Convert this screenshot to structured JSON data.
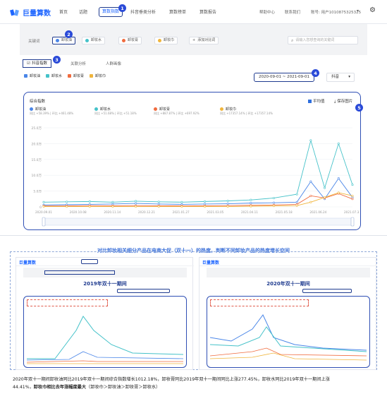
{
  "app": {
    "name": "巨量算数"
  },
  "nav": {
    "items": [
      "首页",
      "话题",
      "算数指数",
      "抖音垂类分析",
      "算数榜单",
      "算数报告"
    ],
    "active_index": 2
  },
  "top_right": {
    "help": "帮助中心",
    "contact": "联系我们",
    "user": "账号: 用户1010875325325"
  },
  "keywords": {
    "label": "关键词",
    "items": [
      "卸妆油",
      "卸妆水",
      "卸妆膏",
      "卸妆巾"
    ],
    "add_label": "添加对比词",
    "search_placeholder": "请输入您想查询的关键词"
  },
  "tabs": {
    "items": [
      "抖音指数",
      "关联分析",
      "人群画像"
    ]
  },
  "legend_filters": [
    "卸妆油",
    "卸妆水",
    "卸妆膏",
    "卸妆巾"
  ],
  "date_range": "2020-09-01 ~ 2021-09-01",
  "platform": "抖音",
  "chart": {
    "title": "综合指数",
    "avg_label": "平均值",
    "save_label": "保存图片"
  },
  "series_meta": [
    {
      "name": "卸妆油",
      "color": "#4a86e8",
      "stat": "同比 +58.39% | 环比 +461.48%"
    },
    {
      "name": "卸妆水",
      "color": "#45c2c9",
      "stat": "同比 +51.68% | 环比 +51.18%"
    },
    {
      "name": "卸妆膏",
      "color": "#f06b3e",
      "stat": "同比 +887.87% | 环比 +697.92%"
    },
    {
      "name": "卸妆巾",
      "color": "#f0b53c",
      "stat": "同比 +17357.14% | 环比 +17357.14%"
    }
  ],
  "chart_data": {
    "type": "line",
    "title": "综合指数",
    "ylim": [
      0,
      25000
    ],
    "yticks": [
      "25.0万",
      "20.0万",
      "15.0万",
      "10.0万",
      "5.0万",
      "0"
    ],
    "x": [
      "2020.09.01",
      "2020.10.08",
      "2020.11.14",
      "2020.12.21",
      "2021.01.27",
      "2021.03.05",
      "2021.04.11",
      "2021.05.18",
      "2021.06.24",
      "2021.07.31"
    ],
    "series": [
      {
        "name": "卸妆油",
        "values": [
          600,
          700,
          800,
          900,
          1100,
          900,
          800,
          900,
          1000,
          1200,
          1300,
          1500,
          8000,
          2500,
          9000,
          3000
        ]
      },
      {
        "name": "卸妆水",
        "values": [
          1500,
          1600,
          1700,
          1500,
          1800,
          1600,
          1500,
          1700,
          1900,
          2200,
          2800,
          4000,
          21000,
          6000,
          20000,
          7000
        ]
      },
      {
        "name": "卸妆膏",
        "values": [
          300,
          300,
          400,
          350,
          400,
          350,
          300,
          350,
          400,
          500,
          600,
          800,
          3500,
          2800,
          4200,
          2500
        ]
      },
      {
        "name": "卸妆巾",
        "values": [
          100,
          100,
          100,
          100,
          100,
          100,
          100,
          100,
          100,
          200,
          300,
          400,
          1500,
          3000,
          4500,
          3500
        ]
      }
    ]
  },
  "mid_title": "对比卸妆相关细分产品在电商大促（双十一）的热度，判断不同卸妆产品的热度增长空间",
  "left_panel_title": "2019年双十一期间",
  "right_panel_title": "2020年双十一期间",
  "bottom_text_1": "2020年双十一期间卸妆油同比2019年双十一期间综合指数增长1012.18%，卸妆膏同比2019年双十一期间同比上涨277.45%，卸妆水同比2019年双十一期间上涨",
  "bottom_text_2": "44.41%，",
  "bottom_text_bold": "卸妆巾相比去年涨幅度最大",
  "bottom_text_3": "（卸妆巾＞卸妆油＞卸妆膏＞卸妆水）",
  "badges": [
    "1",
    "2",
    "3",
    "4",
    "5"
  ]
}
